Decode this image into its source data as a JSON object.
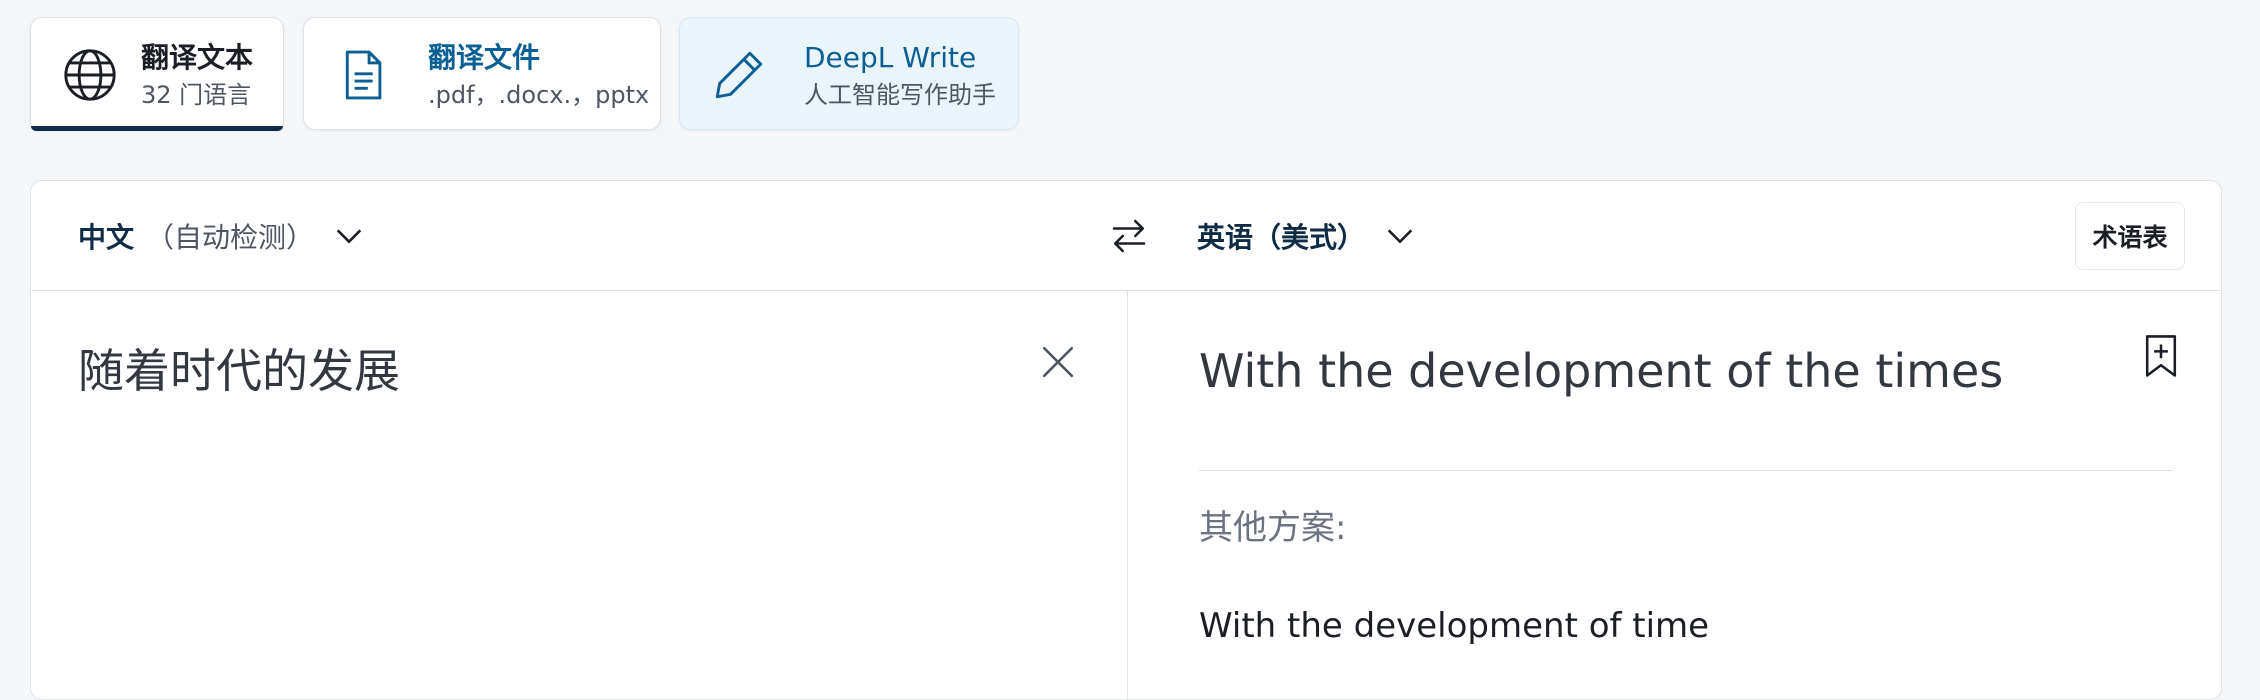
{
  "modes": {
    "text": {
      "title": "翻译文本",
      "subtitle": "32 门语言",
      "icon": "globe-icon"
    },
    "files": {
      "title": "翻译文件",
      "subtitle": ".pdf，.docx.，pptx",
      "icon": "document-icon"
    },
    "write": {
      "title": "DeepL Write",
      "subtitle": "人工智能写作助手",
      "icon": "pencil-icon"
    }
  },
  "languages": {
    "source_name": "中文",
    "source_detect": "（自动检测）",
    "target_name": "英语（美式）",
    "glossary_label": "术语表"
  },
  "source": {
    "text": "随着时代的发展"
  },
  "target": {
    "text": "With the development of the times",
    "alternatives_heading": "其他方案:",
    "alternatives": [
      "With the development of time"
    ]
  },
  "colors": {
    "accent": "#0b5f93",
    "active_underline": "#0f2b46",
    "write_tab_bg": "#eaf5fb"
  }
}
